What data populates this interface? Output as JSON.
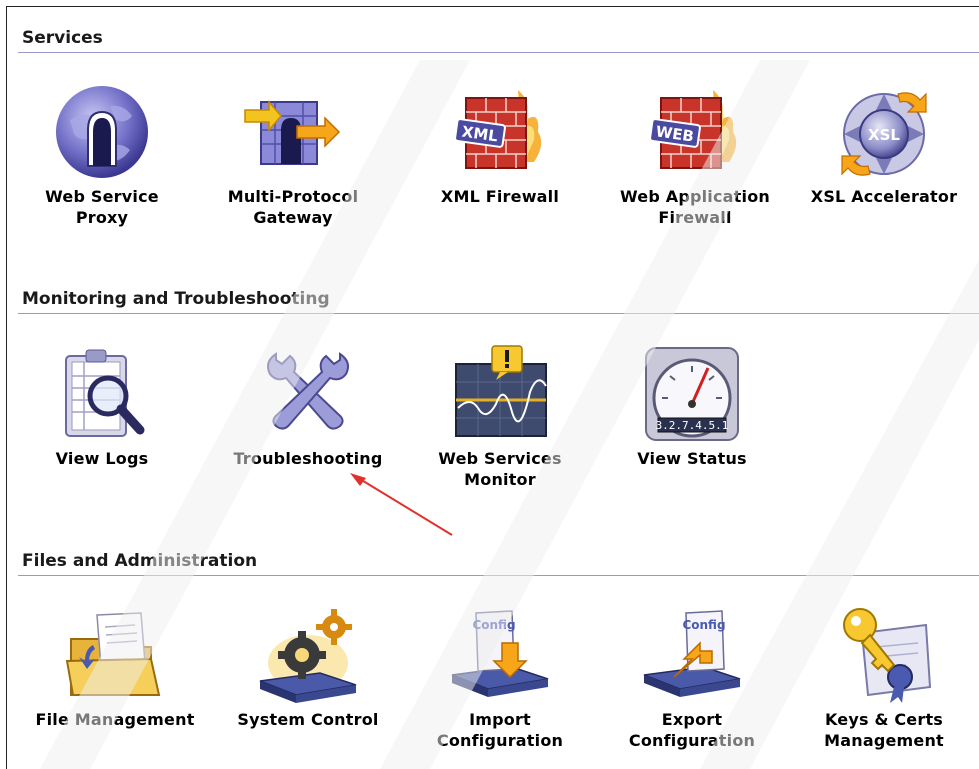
{
  "sections": [
    {
      "title": "Services",
      "tiles": [
        {
          "label": "Web Service\nProxy",
          "icon": "globe-door-icon"
        },
        {
          "label": "Multi-Protocol\nGateway",
          "icon": "gateway-arrow-icon"
        },
        {
          "label": "XML Firewall",
          "icon": "xml-firewall-icon"
        },
        {
          "label": "Web Application\nFirewall",
          "icon": "web-firewall-icon"
        },
        {
          "label": "XSL Accelerator",
          "icon": "xsl-accelerator-icon"
        }
      ]
    },
    {
      "title": "Monitoring and Troubleshooting",
      "tiles": [
        {
          "label": "View Logs",
          "icon": "clipboard-magnifier-icon"
        },
        {
          "label": "Troubleshooting",
          "icon": "wrenches-icon"
        },
        {
          "label": "Web Services\nMonitor",
          "icon": "monitor-graph-icon"
        },
        {
          "label": "View Status",
          "icon": "gauge-icon"
        }
      ]
    },
    {
      "title": "Files and Administration",
      "tiles": [
        {
          "label": "File Management",
          "icon": "folder-icon"
        },
        {
          "label": "System Control",
          "icon": "gears-device-icon"
        },
        {
          "label": "Import\nConfiguration",
          "icon": "config-import-icon"
        },
        {
          "label": "Export\nConfiguration",
          "icon": "config-export-icon"
        },
        {
          "label": "Keys & Certs\nManagement",
          "icon": "key-certificate-icon"
        }
      ]
    }
  ],
  "icon_text": {
    "xml": "XML",
    "web": "WEB",
    "xsl": "XSL",
    "config": "Config",
    "odometer": "3.2.7.4.5.1"
  },
  "colors": {
    "section_rule": "#9a9ac8",
    "arrow": "#e0322c"
  }
}
